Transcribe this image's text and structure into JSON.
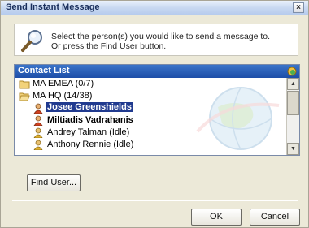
{
  "window": {
    "title": "Send Instant Message",
    "close_glyph": "×"
  },
  "info": {
    "icon": "magnifier-icon",
    "line1": "Select the person(s) you would like to send a message to.",
    "line2": "Or press the Find User button."
  },
  "contact_list": {
    "header": "Contact List",
    "header_icon": "contact-status-icon",
    "items": [
      {
        "type": "group",
        "label": "MA EMEA  (0/7)",
        "icon": "folder-icon"
      },
      {
        "type": "group",
        "label": "MA HQ  (14/38)",
        "icon": "open-folder-icon"
      },
      {
        "type": "contact",
        "label": "Josee Greenshields",
        "status": "online",
        "selected": true,
        "icon": "person-online-icon"
      },
      {
        "type": "contact",
        "label": "Miltiadis Vadrahanis",
        "status": "online",
        "icon": "person-online-icon"
      },
      {
        "type": "contact",
        "label": "Andrey Talman  (Idle)",
        "status": "idle",
        "icon": "person-idle-icon"
      },
      {
        "type": "contact",
        "label": "Anthony Rennie  (Idle)",
        "status": "idle",
        "icon": "person-idle-icon"
      }
    ]
  },
  "buttons": {
    "find_user": "Find User...",
    "ok": "OK",
    "cancel": "Cancel"
  }
}
